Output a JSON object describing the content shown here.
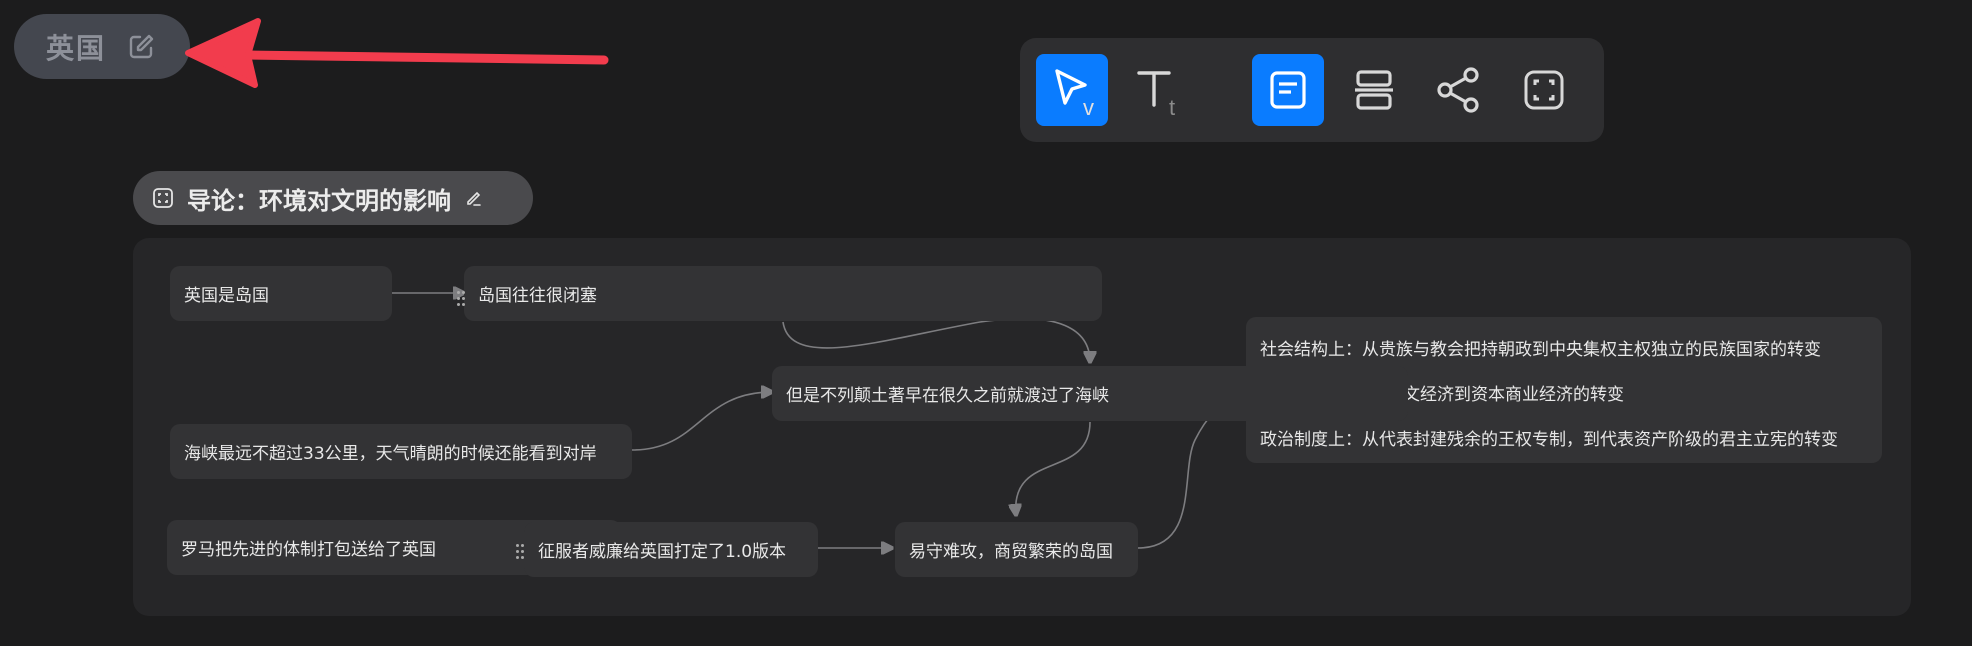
{
  "header": {
    "title": "英国"
  },
  "toolbar": {
    "select_shortcut": "v",
    "text_shortcut": "t",
    "tools": [
      "select-tool",
      "text-tool",
      "card-tool",
      "layout-tool",
      "share-tool",
      "frame-tool"
    ]
  },
  "section": {
    "title": "导论：环境对文明的影响"
  },
  "cards": {
    "c1": "英国是岛国",
    "c2": "岛国往往很闭塞",
    "c3": "但是不列颠土著早在很久之前就渡过了海峡",
    "c4": "海峡最远不超过33公里，天气晴朗的时候还能看到对岸",
    "c5": "罗马把先进的体制打包送给了英国",
    "c6": "征服者威廉给英国打定了1.0版本",
    "c7": "易守难攻，商贸繁荣的岛国"
  },
  "big_card": {
    "line1": "社会结构上：从贵族与教会把持朝政到中央集权主权独立的民族国家的转变",
    "line2_partial": "文经济到资本商业经济的转变",
    "line3": "政治制度上：从代表封建残余的王权专制，到代表资产阶级的君主立宪的转变"
  },
  "colors": {
    "background": "#1c1c1d",
    "accent": "#0a7cff",
    "annotation_arrow": "#f23c4d"
  }
}
